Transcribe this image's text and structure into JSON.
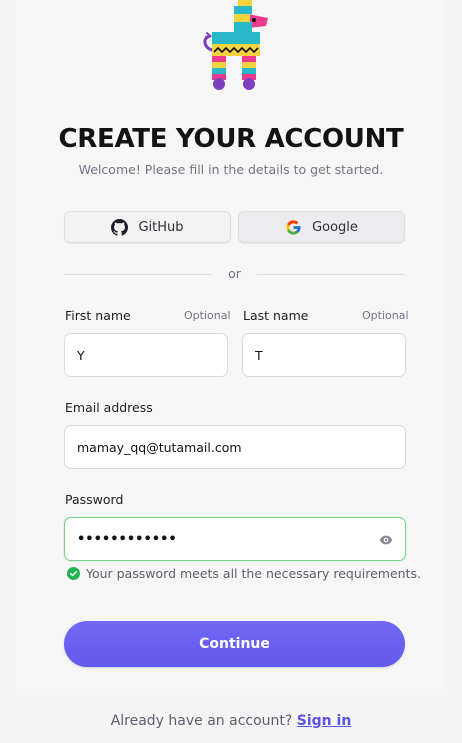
{
  "header": {
    "title": "CREATE YOUR ACCOUNT",
    "subtitle": "Welcome! Please fill in the details to get started.",
    "logo_icon": "pinata-llama-logo"
  },
  "social": {
    "github_label": "GitHub",
    "google_label": "Google"
  },
  "divider_text": "or",
  "form": {
    "first_name": {
      "label": "First name",
      "optional": "Optional",
      "value": "Y"
    },
    "last_name": {
      "label": "Last name",
      "optional": "Optional",
      "value": "T"
    },
    "email": {
      "label": "Email address",
      "value": "mamay_qq@tutamail.com"
    },
    "password": {
      "label": "Password",
      "masked_value": "••••••••••••",
      "hint": "Your password meets all the necessary requirements."
    },
    "continue_label": "Continue"
  },
  "footer": {
    "prompt": "Already have an account?",
    "sign_in_label": "Sign in"
  },
  "colors": {
    "accent": "#6c63f2",
    "valid": "#22b357",
    "valid_border": "#7ad28b"
  }
}
